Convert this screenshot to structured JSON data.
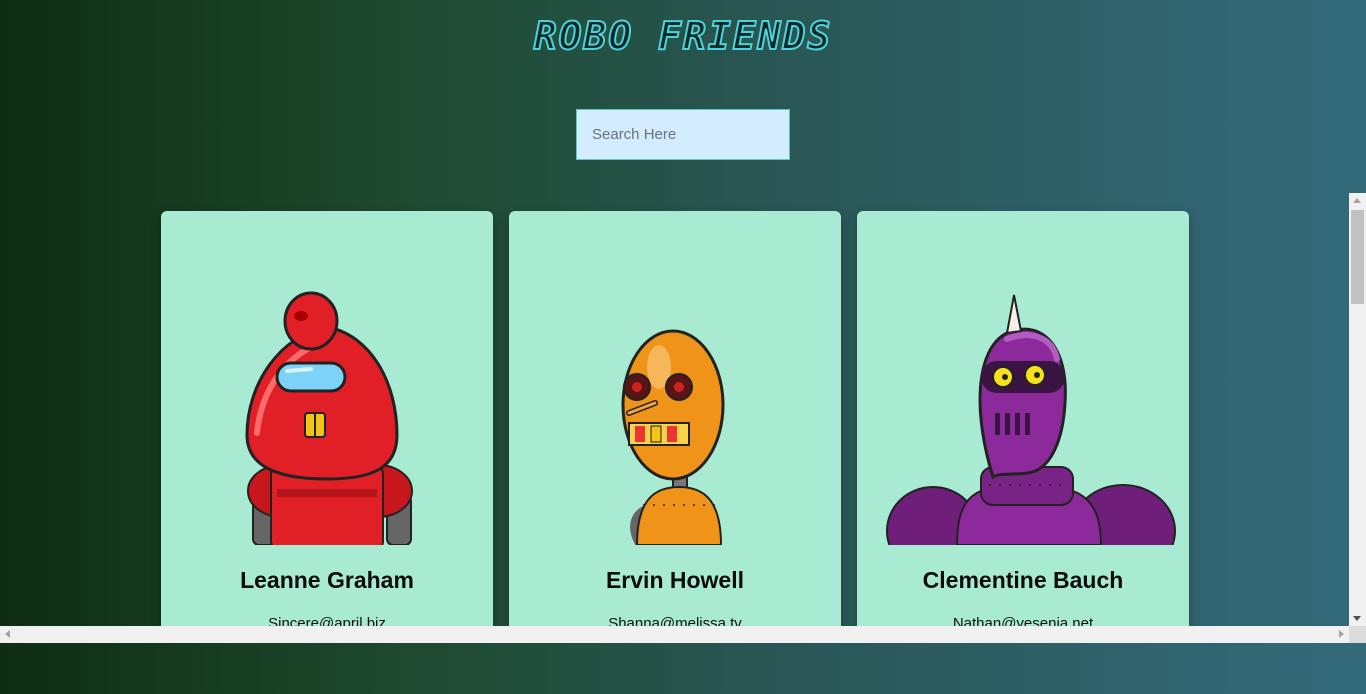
{
  "header": {
    "title": "ROBO FRIENDS"
  },
  "search": {
    "placeholder": "Search Here",
    "value": ""
  },
  "robots": [
    {
      "name": "Leanne Graham",
      "email": "Sincere@april.biz",
      "color": "#e11f26",
      "image_icon": "red-robot-avatar"
    },
    {
      "name": "Ervin Howell",
      "email": "Shanna@melissa.tv",
      "color": "#ef9418",
      "image_icon": "orange-robot-avatar"
    },
    {
      "name": "Clementine Bauch",
      "email": "Nathan@yesenia.net",
      "color": "#8d2a9b",
      "image_icon": "purple-robot-avatar"
    }
  ],
  "colors": {
    "card_bg": "#a8ebd2",
    "search_bg": "#d3ecff",
    "title_stroke": "#4fd1d9"
  }
}
